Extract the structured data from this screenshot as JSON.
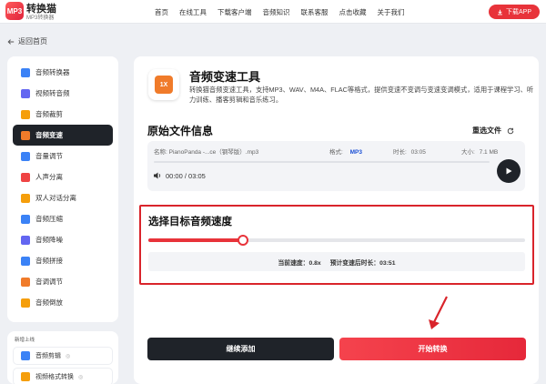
{
  "header": {
    "logo_text": "MP3",
    "brand": "转换猫",
    "brand_sub": "MP3转换器",
    "nav": [
      "首页",
      "在线工具",
      "下载客户端",
      "音频知识",
      "联系客服",
      "点击收藏",
      "关于我们"
    ],
    "download_label": "下载APP"
  },
  "back_label": "返回首页",
  "sidebar": {
    "items": [
      {
        "label": "音频转换器",
        "color": "#3b82f6"
      },
      {
        "label": "视频转音频",
        "color": "#6366f1"
      },
      {
        "label": "音频裁剪",
        "color": "#f59e0b"
      },
      {
        "label": "音频变速",
        "color": "#f07b2a"
      },
      {
        "label": "音量调节",
        "color": "#3b82f6"
      },
      {
        "label": "人声分离",
        "color": "#ef4444"
      },
      {
        "label": "双人对话分离",
        "color": "#f59e0b"
      },
      {
        "label": "音频压缩",
        "color": "#3b82f6"
      },
      {
        "label": "音频降噪",
        "color": "#6366f1"
      },
      {
        "label": "音频拼接",
        "color": "#3b82f6"
      },
      {
        "label": "音调调节",
        "color": "#f07b2a"
      },
      {
        "label": "音频倒放",
        "color": "#f59e0b"
      }
    ],
    "active_index": 3,
    "new_label": "新增上线",
    "new_items": [
      {
        "label": "音频剪辑",
        "tag": "◎"
      },
      {
        "label": "视频格式转换",
        "tag": "◎"
      }
    ]
  },
  "tool": {
    "icon_text": "1X",
    "title": "音频变速工具",
    "description": "转换猫音频变速工具，支持MP3、WAV、M4A、FLAC等格式，提供变速不变调与变速变调模式，适用于课程学习、听力训练、播客剪辑和音乐练习。"
  },
  "original": {
    "title": "原始文件信息",
    "reselect": "重选文件",
    "name_label": "名称:",
    "name_value": "PianoPanda -...ce（钢琴版）.mp3",
    "format_label": "格式:",
    "format_value": "MP3",
    "duration_label": "时长:",
    "duration_value": "03:05",
    "size_label": "大小:",
    "size_value": "7.1 MB",
    "time_display": "00:00 / 03:05"
  },
  "speed": {
    "title": "选择目标音频速度",
    "value_fraction": 0.25,
    "current_label": "当前速度：",
    "current_value": "0.8x",
    "estimate_label": "预计变速后时长：",
    "estimate_value": "03:51"
  },
  "actions": {
    "continue": "继续添加",
    "start": "开始转换"
  },
  "colors": {
    "accent": "#e8333a",
    "dark": "#1f2329",
    "highlight_border": "#d9242b"
  }
}
